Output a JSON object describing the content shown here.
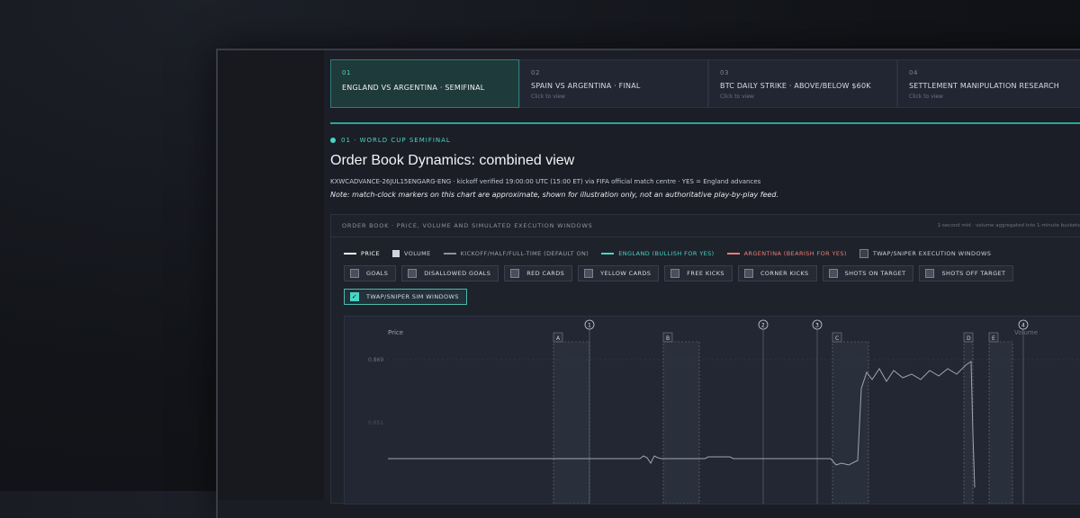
{
  "tabs": [
    {
      "num": "01",
      "title": "ENGLAND VS ARGENTINA · SEMIFINAL",
      "sub": ""
    },
    {
      "num": "02",
      "title": "SPAIN VS ARGENTINA · FINAL",
      "sub": "Click to view"
    },
    {
      "num": "03",
      "title": "BTC DAILY STRIKE · ABOVE/BELOW $60K",
      "sub": "Click to view"
    },
    {
      "num": "04",
      "title": "SETTLEMENT MANIPULATION RESEARCH",
      "sub": "Click to view"
    }
  ],
  "eyebrow": "01 · WORLD CUP SEMIFINAL",
  "title": "Order Book Dynamics: combined view",
  "meta": "KXWCADVANCE-26JUL15ENGARG-ENG · kickoff verified 19:00:00 UTC (15:00 ET) via FIFA official match centre · YES = England advances",
  "note": "Note: match-clock markers on this chart are approximate, shown for illustration only, not an authoritative play-by-play feed.",
  "panel": {
    "title": "ORDER BOOK · PRICE, VOLUME AND SIMULATED EXECUTION WINDOWS",
    "right": "1-second mid · volume aggregated into 1-minute buckets"
  },
  "legend": [
    {
      "label": "PRICE",
      "color": "#ffffff",
      "kind": "line"
    },
    {
      "label": "VOLUME",
      "color": "#d0d4dc",
      "kind": "box"
    },
    {
      "label": "KICKOFF/HALF/FULL-TIME (DEFAULT ON)",
      "color": "#8b93a2",
      "kind": "line"
    },
    {
      "label": "ENGLAND (BULLISH FOR YES)",
      "color": "#49d6c6",
      "kind": "line"
    },
    {
      "label": "ARGENTINA (BEARISH FOR YES)",
      "color": "#ef7d77",
      "kind": "line"
    },
    {
      "label": "TWAP/SNIPER EXECUTION WINDOWS",
      "color": "#5a5f6b",
      "kind": "box"
    }
  ],
  "filters": [
    "GOALS",
    "DISALLOWED GOALS",
    "RED CARDS",
    "YELLOW CARDS",
    "FREE KICKS",
    "CORNER KICKS",
    "SHOTS ON TARGET",
    "SHOTS OFF TARGET"
  ],
  "filter_on": "TWAP/SNIPER SIM WINDOWS",
  "chart_data": {
    "type": "line",
    "y_label": "Price",
    "y2_label": "Volume",
    "y_ticks": [
      "0.869",
      "0.651"
    ],
    "window_labels": [
      "A",
      "B",
      "C",
      "D",
      "E"
    ],
    "marker_labels": [
      "1",
      "2",
      "3",
      "4"
    ]
  }
}
